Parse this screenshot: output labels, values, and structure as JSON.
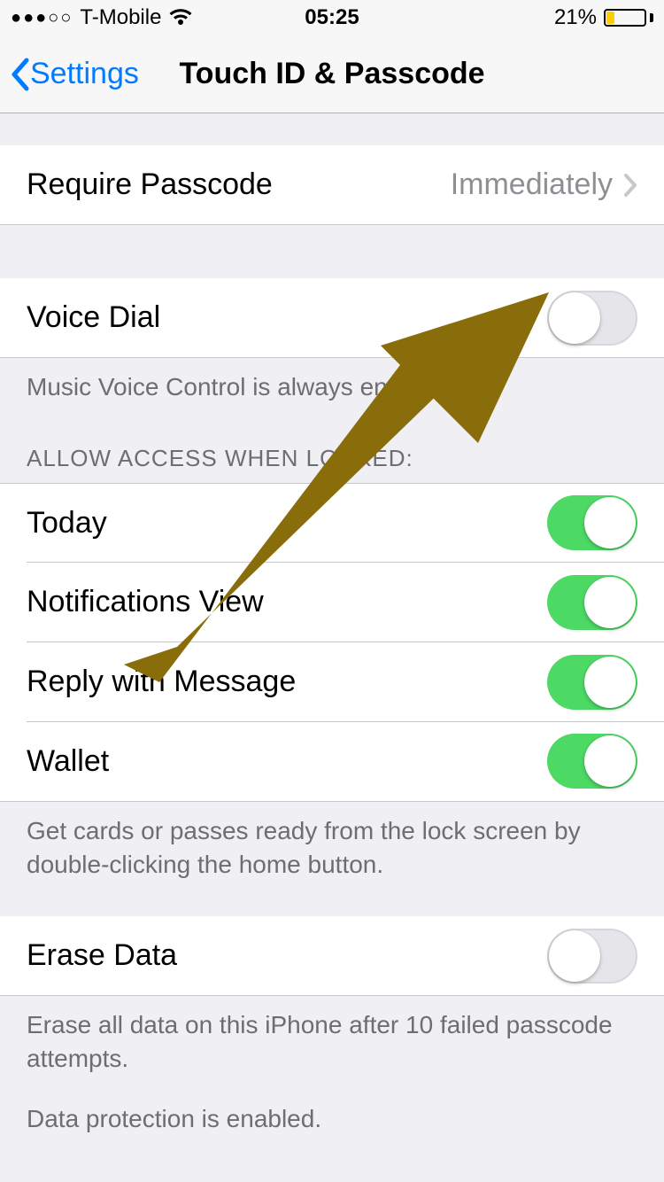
{
  "status": {
    "signal_dots": "●●●○○",
    "carrier": "T-Mobile",
    "time": "05:25",
    "battery_pct": "21%"
  },
  "nav": {
    "back_label": "Settings",
    "title": "Touch ID & Passcode"
  },
  "require_passcode": {
    "label": "Require Passcode",
    "value": "Immediately"
  },
  "voice_dial": {
    "label": "Voice Dial",
    "on": false,
    "footer": "Music Voice Control is always enabled."
  },
  "allow_access": {
    "header": "ALLOW ACCESS WHEN LOCKED:",
    "items": [
      {
        "label": "Today",
        "on": true
      },
      {
        "label": "Notifications View",
        "on": true
      },
      {
        "label": "Reply with Message",
        "on": true
      },
      {
        "label": "Wallet",
        "on": true
      }
    ],
    "footer": "Get cards or passes ready from the lock screen by double-clicking the home button."
  },
  "erase_data": {
    "label": "Erase Data",
    "on": false,
    "footer1": "Erase all data on this iPhone after 10 failed passcode attempts.",
    "footer2": "Data protection is enabled."
  },
  "annotation": {
    "arrow_color": "#8a6d0b"
  }
}
